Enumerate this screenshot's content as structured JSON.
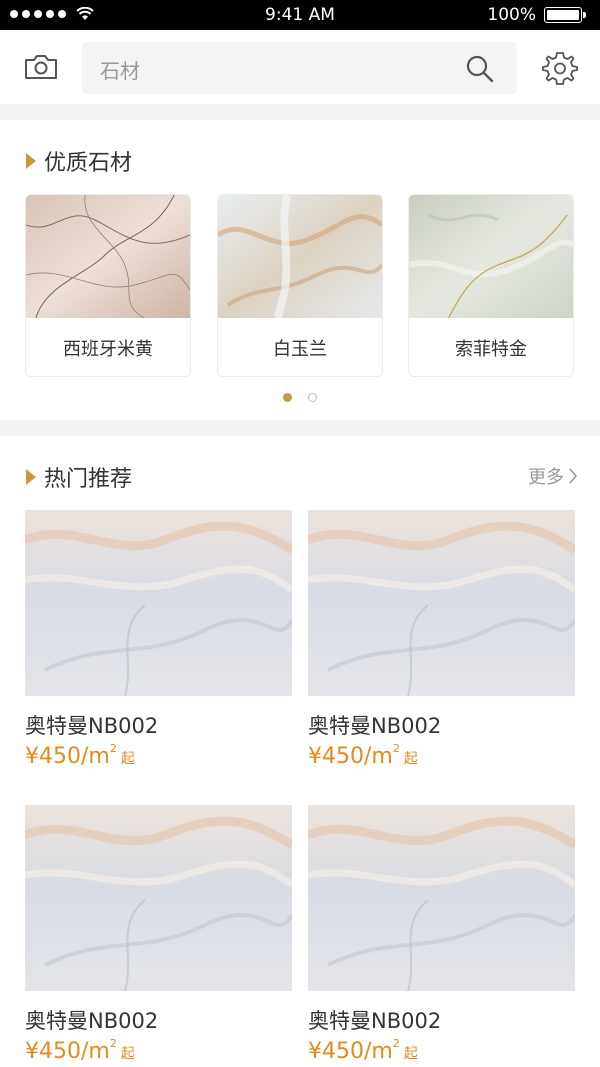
{
  "status_bar": {
    "time": "9:41 AM",
    "battery_pct": "100%"
  },
  "header": {
    "search_placeholder": "石材"
  },
  "featured": {
    "title": "优质石材",
    "items": [
      {
        "label": "西班牙米黄"
      },
      {
        "label": "白玉兰"
      },
      {
        "label": "索菲特金"
      }
    ],
    "page_count": 2,
    "active_page": 1
  },
  "hot": {
    "title": "热门推荐",
    "more_label": "更多",
    "items": [
      {
        "name": "奥特曼NB002",
        "price": "¥450/m",
        "unit_sup": "2",
        "suffix": "起"
      },
      {
        "name": "奥特曼NB002",
        "price": "¥450/m",
        "unit_sup": "2",
        "suffix": "起"
      },
      {
        "name": "奥特曼NB002",
        "price": "¥450/m",
        "unit_sup": "2",
        "suffix": "起"
      },
      {
        "name": "奥特曼NB002",
        "price": "¥450/m",
        "unit_sup": "2",
        "suffix": "起"
      }
    ]
  },
  "colors": {
    "accent": "#c79a3b",
    "price": "#e58a1c",
    "band": "#f2f2f2"
  }
}
